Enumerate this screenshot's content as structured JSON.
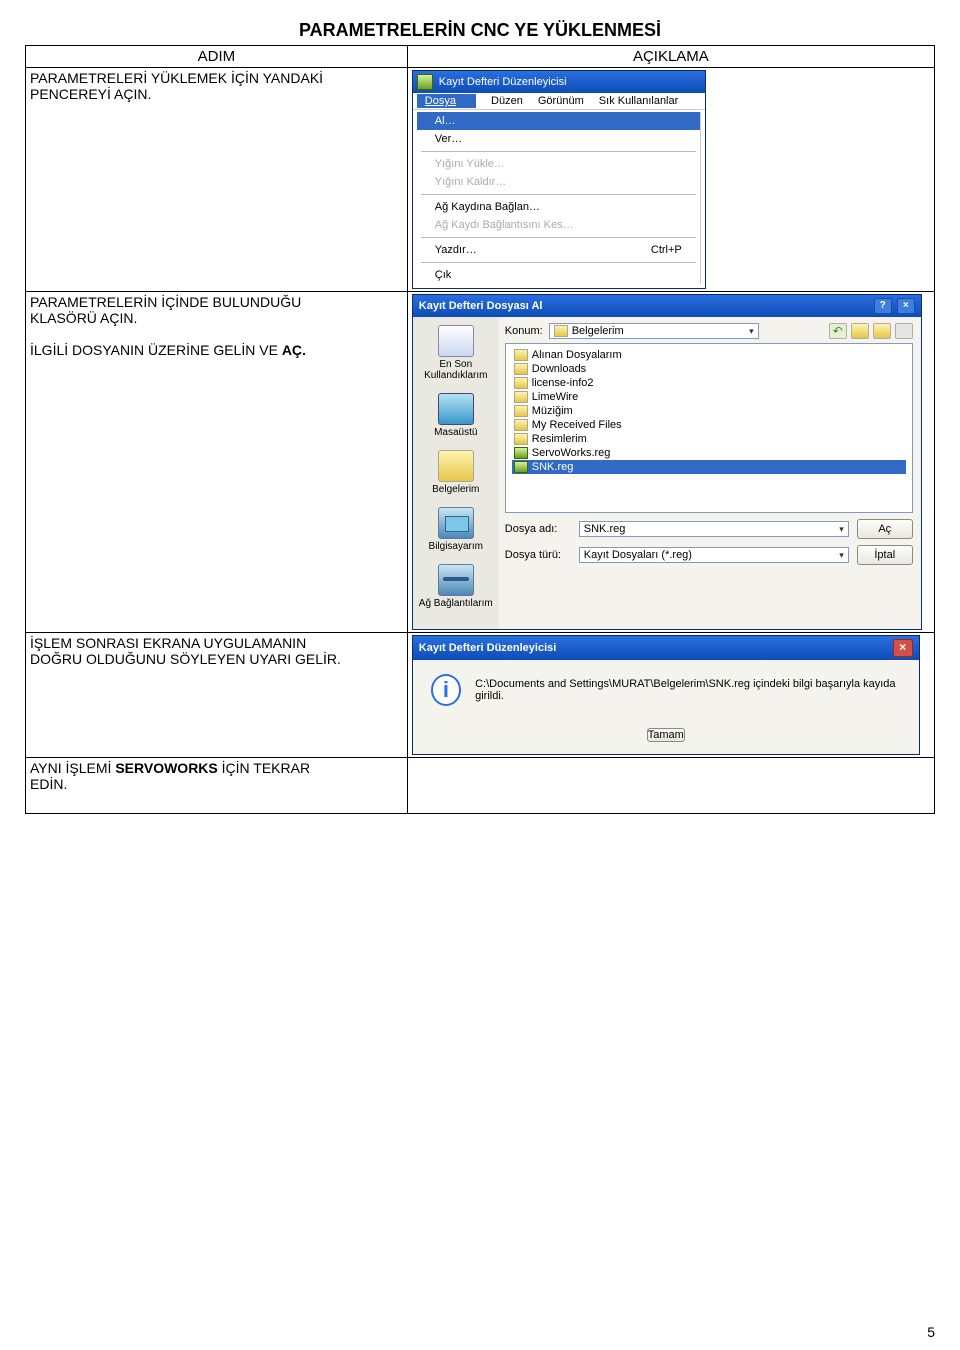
{
  "title": "PARAMETRELERİN CNC YE YÜKLENMESİ",
  "headers": {
    "step": "ADIM",
    "desc": "AÇIKLAMA"
  },
  "step1": {
    "line1": "PARAMETRELERİ YÜKLEMEK İÇİN YANDAKİ",
    "line2": "PENCEREYİ AÇIN."
  },
  "step2": {
    "line1": "PARAMETRELERİN İÇİNDE BULUNDUĞU",
    "line2": "KLASÖRÜ AÇIN.",
    "line3a": "İLGİLİ DOSYANIN ÜZERİNE GELİN VE ",
    "line3b": "AÇ."
  },
  "step3": {
    "line1": "İŞLEM SONRASI EKRANA UYGULAMANIN",
    "line2": "DOĞRU OLDUĞUNU SÖYLEYEN UYARI GELİR."
  },
  "step4": {
    "line1a": "AYNI İŞLEMİ ",
    "line1b": "SERVOWORKS",
    "line1c": " İÇİN TEKRAR",
    "line2": "EDİN."
  },
  "regwin": {
    "title": "Kayıt Defteri Düzenleyicisi",
    "menu": {
      "dosya": "Dosya",
      "duzen": "Düzen",
      "gorunum": "Görünüm",
      "sik": "Sık Kullanılanlar"
    },
    "items": {
      "al": "Al…",
      "ver": "Ver…",
      "yukle": "Yığını Yükle…",
      "kaldir": "Yığını Kaldır…",
      "baglan": "Ağ Kaydına Bağlan…",
      "kes": "Ağ Kaydı Bağlantısını Kes…",
      "yazdir": "Yazdır…",
      "yazdir_sc": "Ctrl+P",
      "cik": "Çık"
    }
  },
  "dialog": {
    "title": "Kayıt Defteri Dosyası Al",
    "konum_lbl": "Konum:",
    "konum_val": "Belgelerim",
    "places": {
      "recent": "En Son Kullandıklarım",
      "desk": "Masaüstü",
      "docs": "Belgelerim",
      "pc": "Bilgisayarım",
      "net": "Ağ Bağlantılarım"
    },
    "files": [
      "Alınan Dosyalarım",
      "Downloads",
      "license-info2",
      "LimeWire",
      "Müziğim",
      "My Received Files",
      "Resimlerim",
      "ServoWorks.reg",
      "SNK.reg"
    ],
    "dosya_adi_lbl": "Dosya adı:",
    "dosya_adi_val": "SNK.reg",
    "dosya_turu_lbl": "Dosya türü:",
    "dosya_turu_val": "Kayıt Dosyaları (*.reg)",
    "ac": "Aç",
    "iptal": "İptal"
  },
  "msg": {
    "title": "Kayıt Defteri Düzenleyicisi",
    "text": "C:\\Documents and Settings\\MURAT\\Belgelerim\\SNK.reg içindeki bilgi başarıyla kayıda girildi.",
    "ok": "Tamam"
  },
  "page_num": "5"
}
